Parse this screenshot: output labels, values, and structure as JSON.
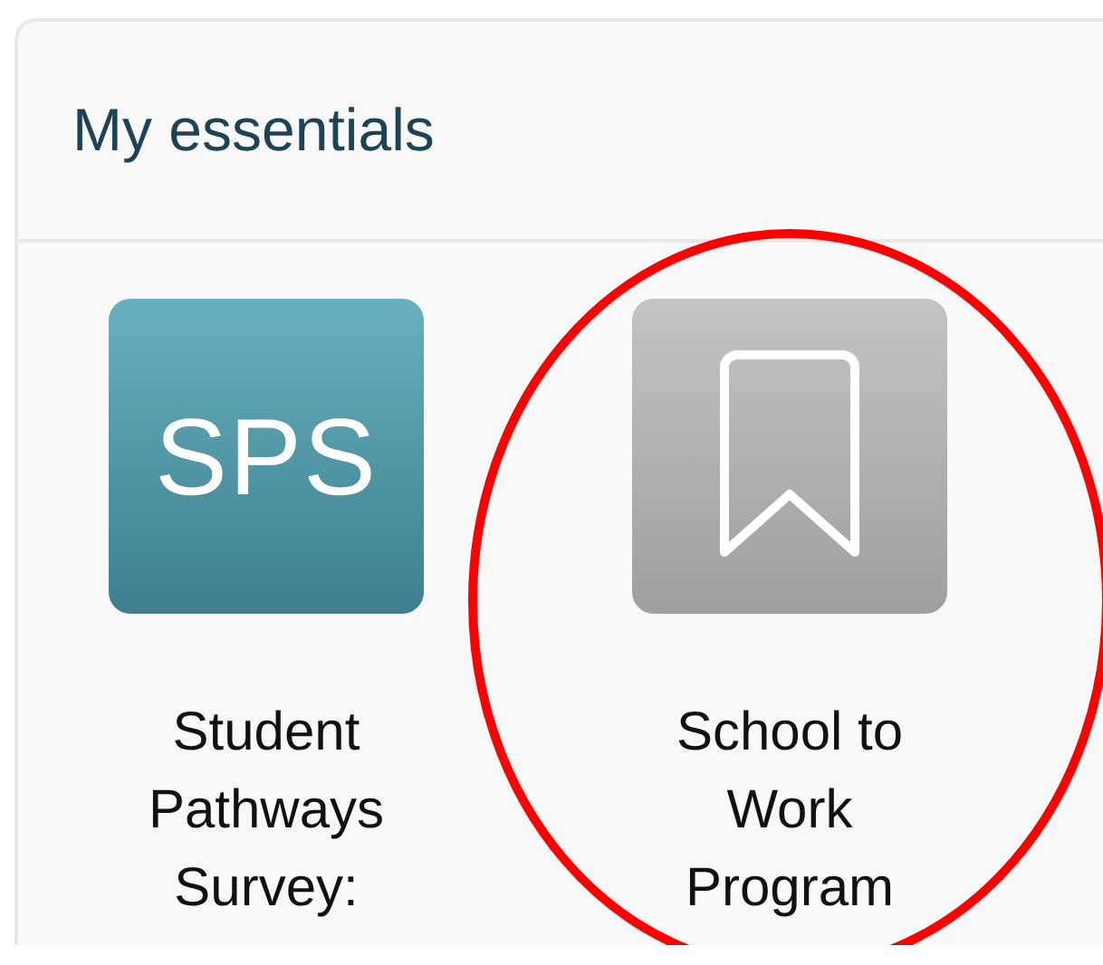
{
  "card": {
    "title": "My essentials"
  },
  "tiles": [
    {
      "kind": "initials",
      "initials": "SPS",
      "label": "Student Pathways Survey:",
      "highlighted": false
    },
    {
      "kind": "bookmark",
      "label": "School to Work Program",
      "highlighted": true
    }
  ]
}
